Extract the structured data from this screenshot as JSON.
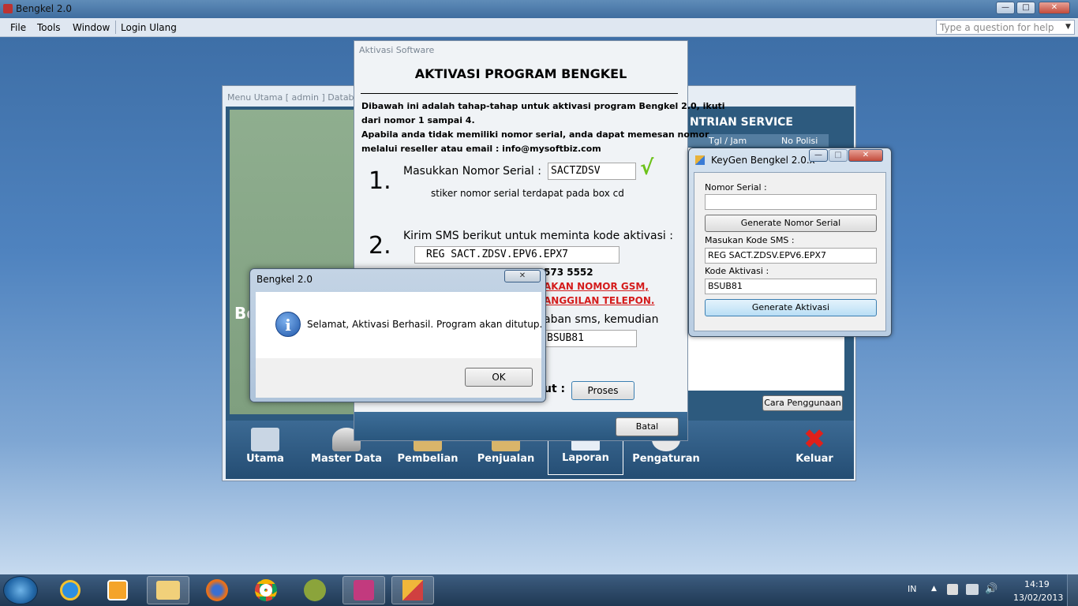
{
  "app": {
    "title": "Bengkel 2.0",
    "menu": [
      "File",
      "Tools",
      "Window",
      "Login Ulang"
    ],
    "help_placeholder": "Type a question for help"
  },
  "menu_utama": {
    "title": "Menu Utama [ admin ] Databa",
    "antrian_title": "NTRIAN SERVICE",
    "col_tgl": "Tgl / Jam",
    "col_polisi": "No Polisi",
    "left_text": "Be",
    "cara_button": "Cara Penggunaan",
    "dock": [
      "Utama",
      "Master Data",
      "Pembelian",
      "Penjualan",
      "Laporan",
      "Pengaturan",
      "Keluar"
    ]
  },
  "aktivasi": {
    "window_title": "Aktivasi Software",
    "heading": "AKTIVASI PROGRAM BENGKEL",
    "intro_line1": "Dibawah ini adalah tahap-tahap untuk aktivasi program Bengkel 2.0, ikuti",
    "intro_line2": "dari nomor 1 sampai 4.",
    "intro_line3": "Apabila anda tidak memiliki nomor serial, anda dapat memesan nomor",
    "intro_line4": "melalui reseller atau email : info@mysoftbiz.com",
    "step1_number": "1.",
    "step1_label": "Masukkan Nomor Serial :",
    "step1_value": "SACTZDSV",
    "step1_check": "√",
    "step1_note": "stiker nomor serial terdapat pada box cd",
    "step2_number": "2.",
    "step2_label": "Kirim SMS berikut untuk meminta kode aktivasi :",
    "step2_value": "REG SACT.ZDSV.EPV6.EPX7",
    "step2_phone_partial": "573 5552",
    "step2_warning1": "AKAN NOMOR GSM,",
    "step2_warning2": "ANGGILAN TELEPON.",
    "step3_label_partial": "aban sms, kemudian",
    "step3_value": "BSUB81",
    "step4_label_partial": "ut :",
    "proses_button": "Proses",
    "batal_button": "Batal"
  },
  "keygen": {
    "title": "KeyGen Bengkel 2.0.x",
    "label_serial": "Nomor Serial :",
    "serial_value": "",
    "generate_serial_button": "Generate Nomor Serial",
    "label_sms": "Masukan Kode SMS :",
    "sms_value": "REG SACT.ZDSV.EPV6.EPX7",
    "label_kode": "Kode Aktivasi :",
    "kode_value": "BSUB81",
    "generate_aktivasi_button": "Generate Aktivasi"
  },
  "msgbox": {
    "title": "Bengkel 2.0",
    "message": "Selamat, Aktivasi Berhasil. Program akan ditutup.",
    "ok_button": "OK",
    "icon": "info-icon"
  },
  "taskbar": {
    "language": "IN",
    "time": "14:19",
    "date": "13/02/2013"
  }
}
